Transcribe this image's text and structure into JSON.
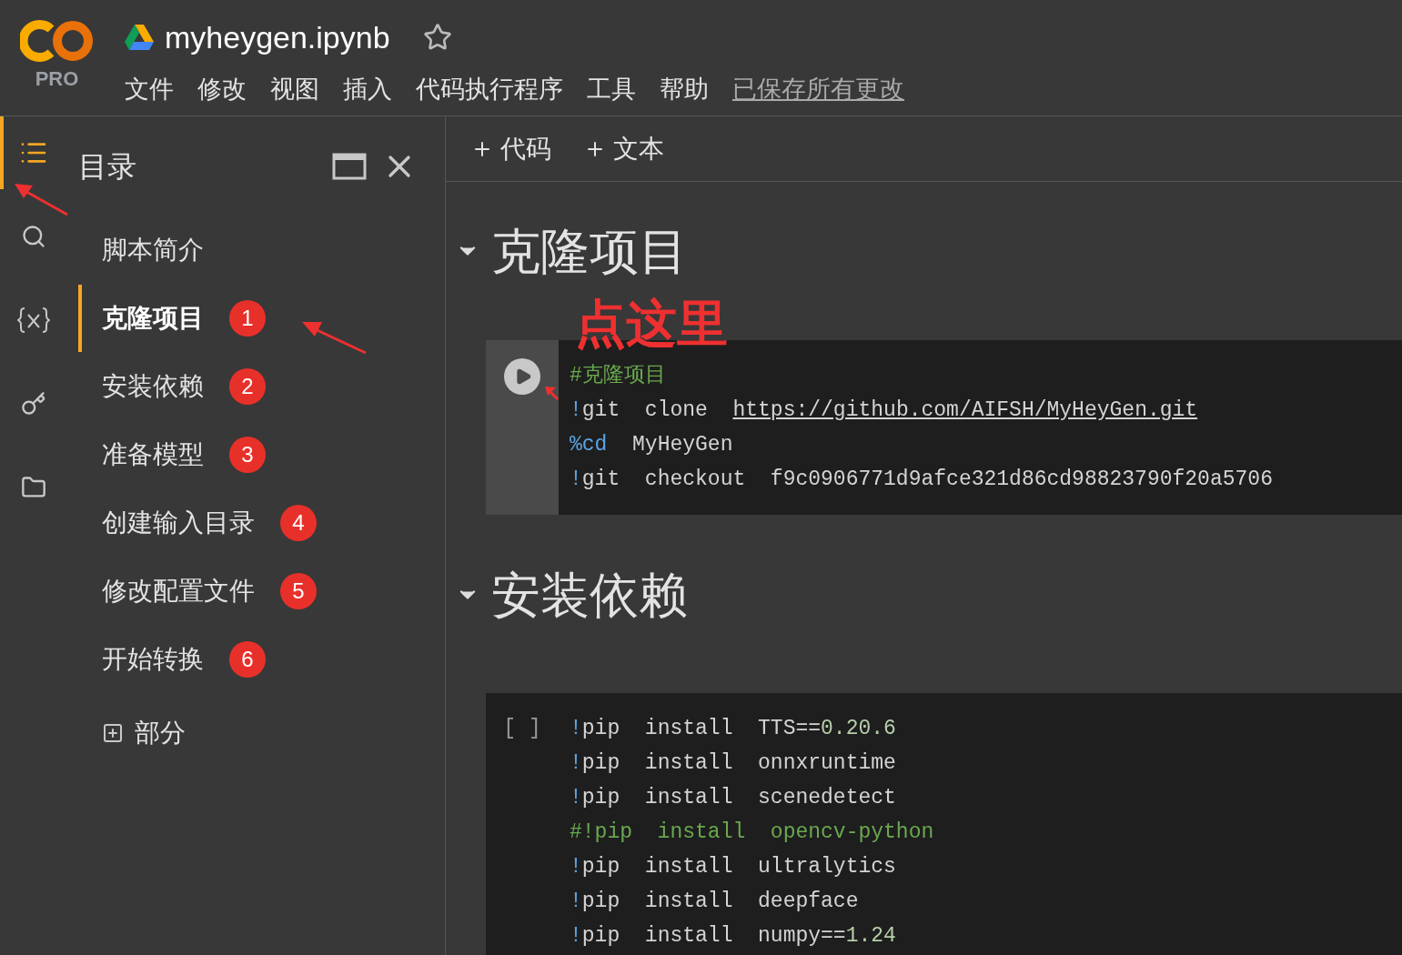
{
  "logo": {
    "badge": "PRO"
  },
  "title": "myheygen.ipynb",
  "menu": [
    "文件",
    "修改",
    "视图",
    "插入",
    "代码执行程序",
    "工具",
    "帮助"
  ],
  "save_status": "已保存所有更改",
  "rail": [
    {
      "kind": "toc",
      "selected": true
    },
    {
      "kind": "search",
      "selected": false
    },
    {
      "kind": "variables",
      "selected": false
    },
    {
      "kind": "secrets",
      "selected": false
    },
    {
      "kind": "files",
      "selected": false
    }
  ],
  "toc": {
    "title": "目录",
    "items": [
      {
        "label": "脚本简介",
        "selected": false
      },
      {
        "label": "克隆项目",
        "selected": true,
        "badge": "1"
      },
      {
        "label": "安装依赖",
        "selected": false,
        "badge": "2"
      },
      {
        "label": "准备模型",
        "selected": false,
        "badge": "3"
      },
      {
        "label": "创建输入目录",
        "selected": false,
        "badge": "4"
      },
      {
        "label": "修改配置文件",
        "selected": false,
        "badge": "5"
      },
      {
        "label": "开始转换",
        "selected": false,
        "badge": "6"
      }
    ],
    "add_section": "部分"
  },
  "toolbar": [
    "代码",
    "文本"
  ],
  "annotation": "点这里",
  "sections": [
    {
      "heading": "克隆项目",
      "expanded": true,
      "cell": {
        "lines": [
          [
            {
              "kind": "comment",
              "t": "#克隆项目"
            }
          ],
          [
            {
              "kind": "bang",
              "t": "!"
            },
            {
              "kind": "plain",
              "t": "git  clone  "
            },
            {
              "kind": "link",
              "t": "https://github.com/AIFSH/MyHeyGen.git"
            }
          ],
          [
            {
              "kind": "bang",
              "t": "%cd"
            },
            {
              "kind": "plain",
              "t": "  MyHeyGen"
            }
          ],
          [
            {
              "kind": "bang",
              "t": "!"
            },
            {
              "kind": "plain",
              "t": "git  checkout  f9c0906771d9afce321d86cd98823790f20a5706"
            }
          ]
        ]
      }
    },
    {
      "heading": "安装依赖",
      "expanded": true,
      "cell": {
        "prompt": "[ ]",
        "lines": [
          [
            {
              "kind": "bang",
              "t": "!"
            },
            {
              "kind": "plain",
              "t": "pip  install  TTS=="
            },
            {
              "kind": "number",
              "t": "0.20.6"
            }
          ],
          [
            {
              "kind": "bang",
              "t": "!"
            },
            {
              "kind": "plain",
              "t": "pip  install  onnxruntime"
            }
          ],
          [
            {
              "kind": "bang",
              "t": "!"
            },
            {
              "kind": "plain",
              "t": "pip  install  scenedetect"
            }
          ],
          [
            {
              "kind": "comment",
              "t": "#!pip  install  opencv-python"
            }
          ],
          [
            {
              "kind": "bang",
              "t": "!"
            },
            {
              "kind": "plain",
              "t": "pip  install  ultralytics"
            }
          ],
          [
            {
              "kind": "bang",
              "t": "!"
            },
            {
              "kind": "plain",
              "t": "pip  install  deepface"
            }
          ],
          [
            {
              "kind": "bang",
              "t": "!"
            },
            {
              "kind": "plain",
              "t": "pip  install  numpy=="
            },
            {
              "kind": "number",
              "t": "1.24"
            }
          ]
        ]
      }
    }
  ]
}
